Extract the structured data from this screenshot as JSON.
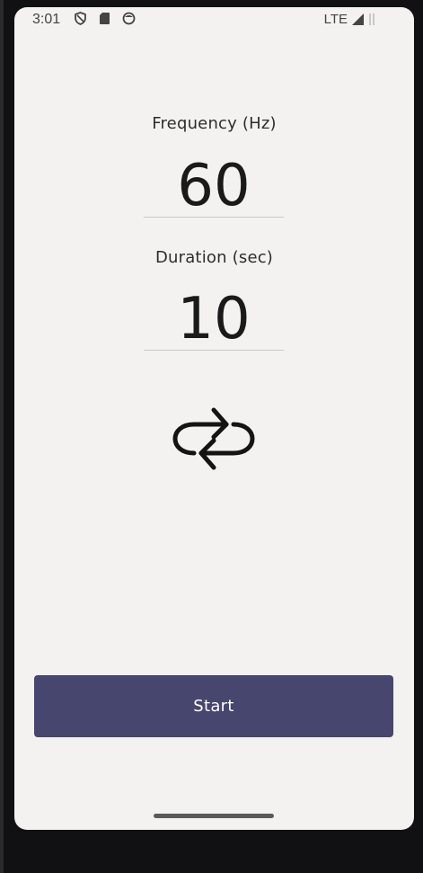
{
  "status_bar": {
    "time": "3:01",
    "network": "LTE",
    "icons": [
      "shield-icon",
      "sd-card-icon",
      "sync-app-icon",
      "signal-icon",
      "battery-icon"
    ]
  },
  "frequency": {
    "label": "Frequency (Hz)",
    "value": "60"
  },
  "duration": {
    "label": "Duration (sec)",
    "value": "10"
  },
  "controls": {
    "repeat_icon": "repeat-icon",
    "start_label": "Start"
  },
  "colors": {
    "screen_background": "#f3f2f0",
    "button_background": "#46466e",
    "button_text": "#ffffff",
    "text": "#1a1a1a"
  }
}
